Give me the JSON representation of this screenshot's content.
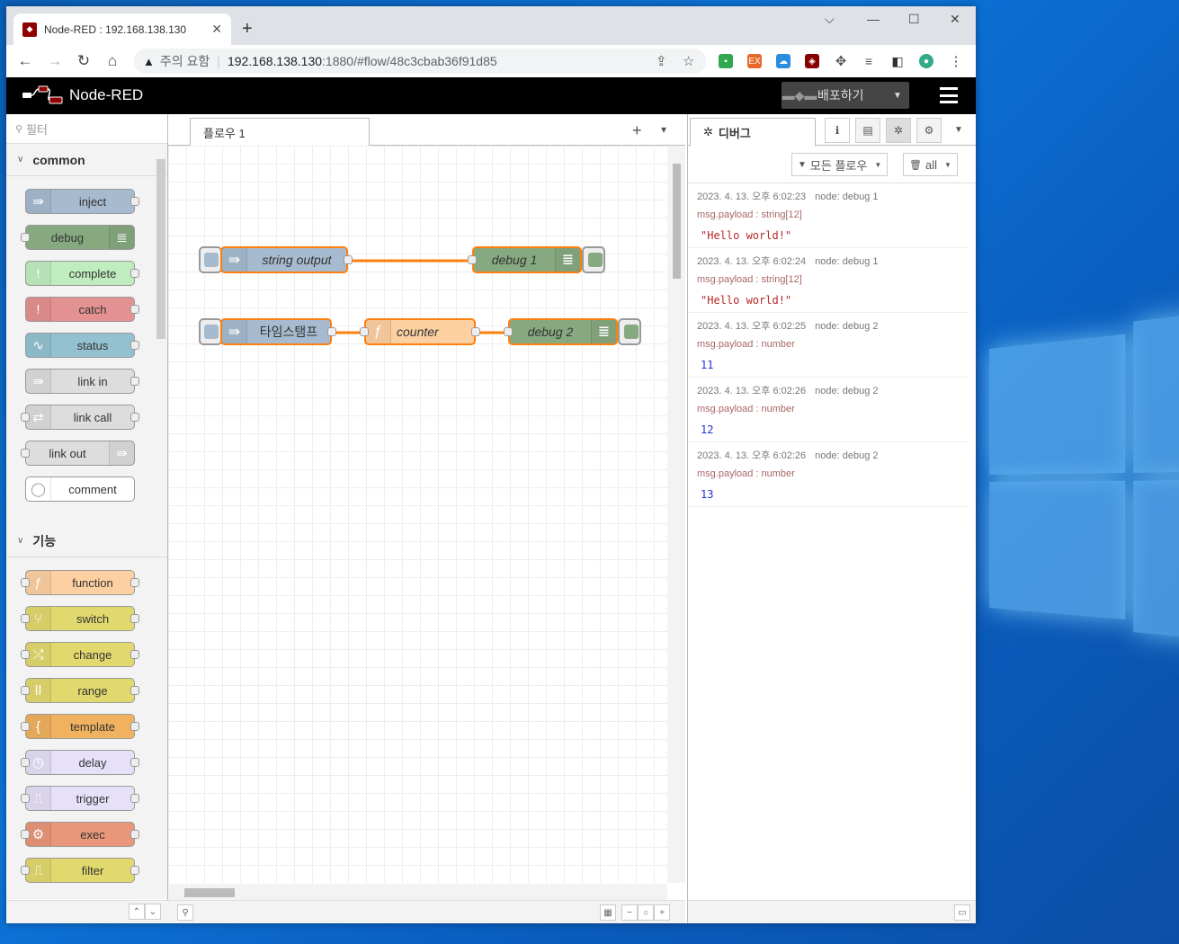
{
  "browser": {
    "tab_title": "Node-RED : 192.168.138.130",
    "tab_close": "✕",
    "new_tab": "+",
    "address": {
      "warning_label": "주의 요함",
      "host": "192.168.138.130",
      "path": ":1880/#flow/48c3cbab36f91d85"
    }
  },
  "header": {
    "app_name": "Node-RED",
    "deploy_label": "배포하기"
  },
  "palette": {
    "filter_placeholder": "필터",
    "categories": [
      {
        "name": "common",
        "nodes": [
          "inject",
          "debug",
          "complete",
          "catch",
          "status",
          "link in",
          "link call",
          "link out",
          "comment"
        ]
      },
      {
        "name": "기능",
        "nodes": [
          "function",
          "switch",
          "change",
          "range",
          "template",
          "delay",
          "trigger",
          "exec",
          "filter"
        ]
      }
    ],
    "colors": {
      "inject": "#a6bbcf",
      "debug": "#87a980",
      "complete": "#c0edc0",
      "catch": "#e49191",
      "status": "#94c1d0",
      "link": "#dddddd",
      "comment": "#ffffff",
      "function": "#fdd0a2",
      "switch": "#e2d96e",
      "change": "#e2d96e",
      "range": "#e2d96e",
      "template": "#f0b25e",
      "delay": "#e6e0f8",
      "trigger": "#e6e0f8",
      "exec": "#e9967a",
      "filter": "#e2d96e"
    }
  },
  "workspace": {
    "tab_label": "플로우 1",
    "add_icon": "+",
    "menu_icon": "▾",
    "flow_nodes": {
      "string_output": "string output",
      "debug1": "debug 1",
      "timestamp": "타임스탬프",
      "counter": "counter",
      "debug2": "debug 2"
    },
    "wire_color": "#ff7f0e"
  },
  "sidebar": {
    "tab_label": "디버그",
    "filter_label": "모든 플로우",
    "clear_label": "all",
    "messages": [
      {
        "time": "2023. 4. 13. 오후 6:02:23",
        "node": "node: debug 1",
        "ptype": "msg.payload : string[12]",
        "value": "\"Hello world!\"",
        "kind": "str"
      },
      {
        "time": "2023. 4. 13. 오후 6:02:24",
        "node": "node: debug 1",
        "ptype": "msg.payload : string[12]",
        "value": "\"Hello world!\"",
        "kind": "str"
      },
      {
        "time": "2023. 4. 13. 오후 6:02:25",
        "node": "node: debug 2",
        "ptype": "msg.payload : number",
        "value": "11",
        "kind": "num"
      },
      {
        "time": "2023. 4. 13. 오후 6:02:26",
        "node": "node: debug 2",
        "ptype": "msg.payload : number",
        "value": "12",
        "kind": "num"
      },
      {
        "time": "2023. 4. 13. 오후 6:02:26",
        "node": "node: debug 2",
        "ptype": "msg.payload : number",
        "value": "13",
        "kind": "num"
      }
    ]
  }
}
